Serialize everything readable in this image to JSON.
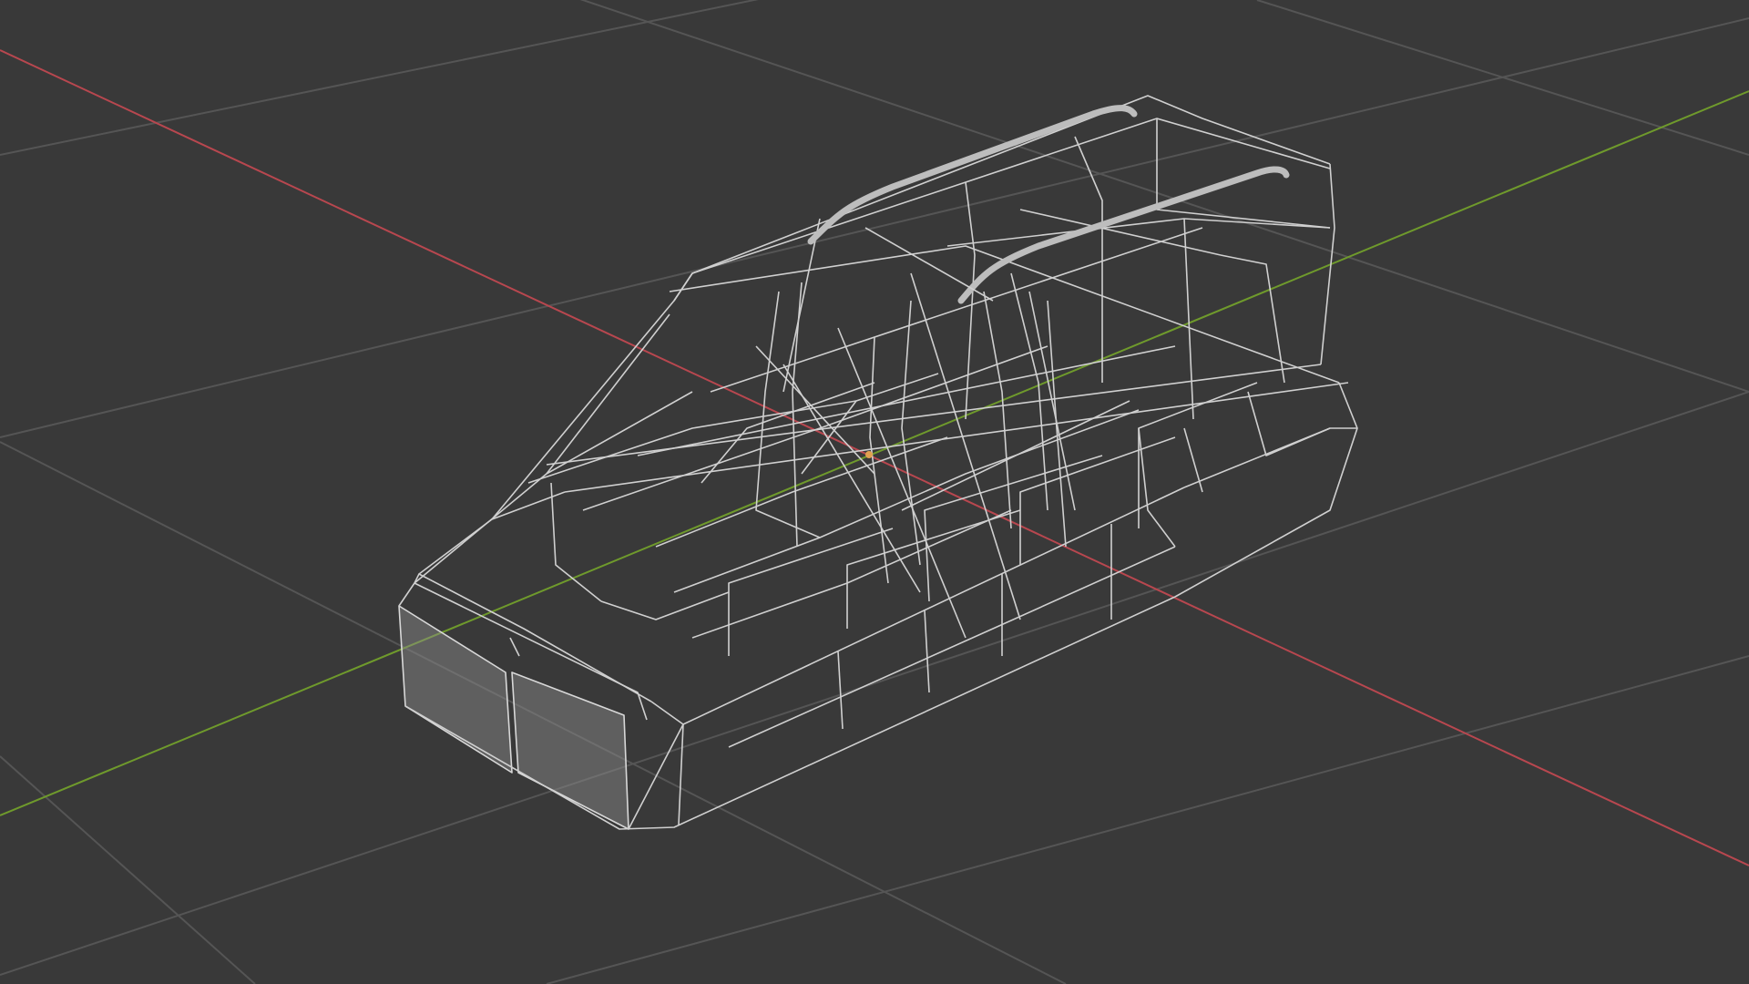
{
  "viewport": {
    "shading_mode": "wireframe",
    "background_color": "#393939",
    "grid_color": "#545454",
    "x_axis_color": "#b8474f",
    "y_axis_color": "#6f9a2c",
    "wire_color": "#d0d0d0",
    "origin_color": "#e0a050"
  },
  "object": {
    "shape": "vehicle cabin",
    "display": "wireframe"
  }
}
